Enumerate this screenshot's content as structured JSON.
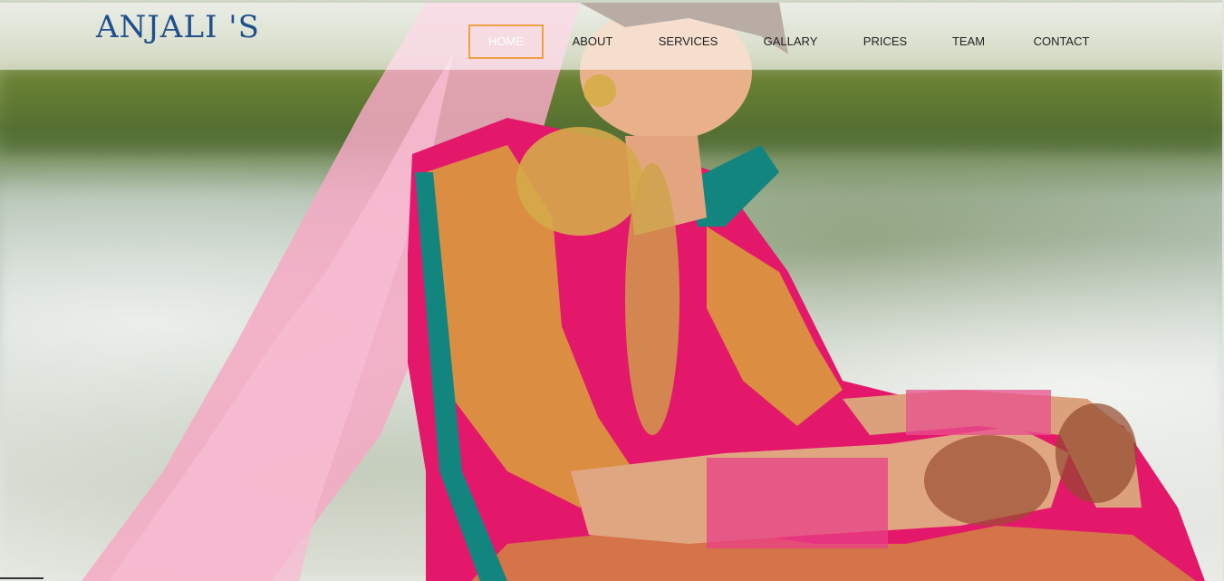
{
  "site": {
    "logo_text": "ANJALI 'S"
  },
  "nav": {
    "items": [
      {
        "label": "HOME",
        "active": true
      },
      {
        "label": "ABOUT",
        "active": false
      },
      {
        "label": "SERVICES",
        "active": false
      },
      {
        "label": "GALLARY",
        "active": false
      },
      {
        "label": "PRICES",
        "active": false
      },
      {
        "label": "TEAM",
        "active": false
      },
      {
        "label": "CONTACT",
        "active": false
      }
    ]
  },
  "colors": {
    "logo": "#1f4f8e",
    "active_border": "#f0a048",
    "nav_text": "#222222",
    "header_overlay": "rgba(255,255,255,0.58)"
  },
  "hero": {
    "image_subject": "bride in pink and gold lehenga"
  }
}
